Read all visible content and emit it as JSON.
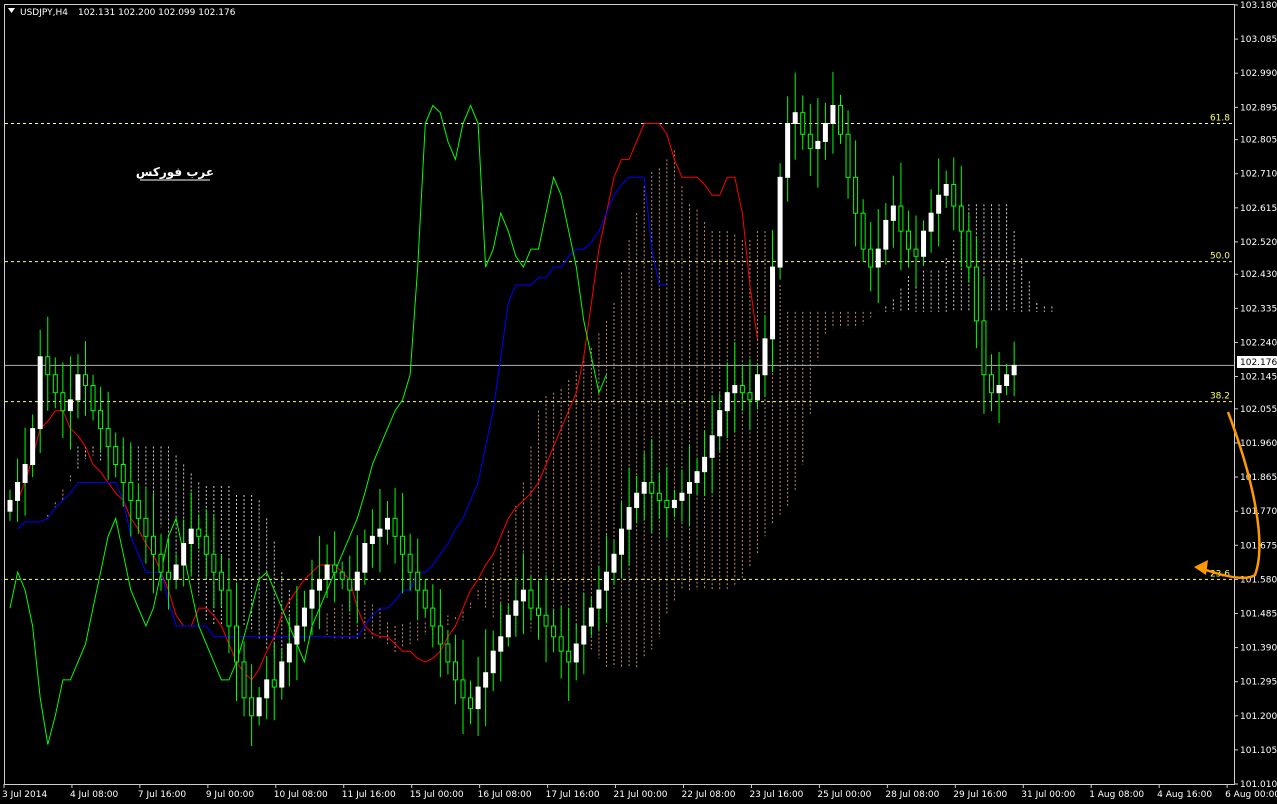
{
  "header": {
    "symbol": "USDJPY,H4",
    "ohlc": "102.131 102.200 102.099 102.176"
  },
  "watermark": "عرب فوركس",
  "current_price_label": "102.176",
  "colors": {
    "background": "#000000",
    "frame": "#cfcfcf",
    "bull_candle": "#ffffff",
    "bear_candle": "#00ff00",
    "wick": "#00ff00",
    "tenkan": "#ff0000",
    "kijun": "#0000ff",
    "chikou": "#00ff00",
    "kumo_a": "#f4b183",
    "kumo_b": "#ffffff",
    "fib_line": "#ffff66",
    "price_line": "#b0b0b0",
    "arrow": "#ff9900"
  },
  "chart_data": {
    "type": "candlestick",
    "instrument": "USDJPY",
    "timeframe": "H4",
    "ylim": [
      101.01,
      103.18
    ],
    "y_ticks": [
      "103.180",
      "103.085",
      "102.990",
      "102.895",
      "102.805",
      "102.710",
      "102.615",
      "102.520",
      "102.430",
      "102.335",
      "102.240",
      "102.145",
      "102.055",
      "101.960",
      "101.865",
      "101.770",
      "101.675",
      "101.580",
      "101.485",
      "101.390",
      "101.295",
      "101.200",
      "101.105",
      "101.010"
    ],
    "x_ticks": [
      {
        "label": "3 Jul 2014",
        "bar": 0
      },
      {
        "label": "4 Jul 08:00",
        "bar": 9
      },
      {
        "label": "7 Jul 16:00",
        "bar": 18
      },
      {
        "label": "9 Jul 00:00",
        "bar": 27
      },
      {
        "label": "10 Jul 08:00",
        "bar": 36
      },
      {
        "label": "11 Jul 16:00",
        "bar": 45
      },
      {
        "label": "15 Jul 00:00",
        "bar": 54
      },
      {
        "label": "16 Jul 08:00",
        "bar": 63
      },
      {
        "label": "17 Jul 16:00",
        "bar": 72
      },
      {
        "label": "21 Jul 00:00",
        "bar": 81
      },
      {
        "label": "22 Jul 08:00",
        "bar": 90
      },
      {
        "label": "23 Jul 16:00",
        "bar": 99
      },
      {
        "label": "25 Jul 00:00",
        "bar": 108
      },
      {
        "label": "28 Jul 08:00",
        "bar": 117
      },
      {
        "label": "29 Jul 16:00",
        "bar": 126
      },
      {
        "label": "31 Jul 00:00",
        "bar": 135
      },
      {
        "label": "1 Aug 08:00",
        "bar": 144
      },
      {
        "label": "4 Aug 16:00",
        "bar": 153
      },
      {
        "label": "6 Aug 00:00",
        "bar": 162
      }
    ],
    "last_price": 102.176,
    "fib_levels": [
      {
        "label": "61.8",
        "price": 102.85
      },
      {
        "label": "50.0",
        "price": 102.465
      },
      {
        "label": "38.2",
        "price": 102.075
      },
      {
        "label": "23.6",
        "price": 101.58
      }
    ],
    "closes": [
      101.8,
      101.85,
      101.9,
      102.0,
      102.2,
      102.15,
      102.1,
      102.05,
      102.08,
      102.15,
      102.12,
      102.05,
      102.0,
      101.95,
      101.9,
      101.85,
      101.8,
      101.75,
      101.7,
      101.65,
      101.6,
      101.58,
      101.62,
      101.68,
      101.72,
      101.7,
      101.65,
      101.6,
      101.55,
      101.45,
      101.35,
      101.25,
      101.2,
      101.25,
      101.3,
      101.28,
      101.35,
      101.4,
      101.45,
      101.5,
      101.55,
      101.58,
      101.62,
      101.6,
      101.58,
      101.55,
      101.6,
      101.68,
      101.7,
      101.72,
      101.75,
      101.7,
      101.65,
      101.6,
      101.55,
      101.5,
      101.45,
      101.4,
      101.35,
      101.3,
      101.25,
      101.22,
      101.28,
      101.32,
      101.38,
      101.42,
      101.48,
      101.52,
      101.55,
      101.5,
      101.48,
      101.45,
      101.42,
      101.38,
      101.35,
      101.4,
      101.45,
      101.5,
      101.55,
      101.6,
      101.65,
      101.72,
      101.78,
      101.82,
      101.85,
      101.82,
      101.8,
      101.78,
      101.8,
      101.82,
      101.85,
      101.88,
      101.92,
      101.98,
      102.05,
      102.1,
      102.12,
      102.1,
      102.08,
      102.15,
      102.25,
      102.45,
      102.7,
      102.85,
      102.88,
      102.82,
      102.78,
      102.8,
      102.85,
      102.9,
      102.82,
      102.7,
      102.6,
      102.5,
      102.45,
      102.5,
      102.58,
      102.62,
      102.55,
      102.5,
      102.48,
      102.55,
      102.6,
      102.65,
      102.68,
      102.62,
      102.55,
      102.45,
      102.3,
      102.15,
      102.1,
      102.12,
      102.15,
      102.176
    ],
    "tenkan": [
      101.8,
      101.85,
      101.92,
      102.0,
      102.02,
      102.05,
      102.05,
      102.0,
      101.98,
      101.95,
      101.9,
      101.88,
      101.85,
      101.82,
      101.8,
      101.75,
      101.72,
      101.68,
      101.65,
      101.6,
      101.55,
      101.48,
      101.45,
      101.45,
      101.5,
      101.5,
      101.48,
      101.45,
      101.4,
      101.35,
      101.32,
      101.3,
      101.33,
      101.38,
      101.42,
      101.48,
      101.52,
      101.55,
      101.58,
      101.6,
      101.62,
      101.62,
      101.62,
      101.6,
      101.58,
      101.5,
      101.45,
      101.43,
      101.42,
      101.42,
      101.4,
      101.38,
      101.38,
      101.36,
      101.35,
      101.36,
      101.38,
      101.42,
      101.45,
      101.5,
      101.55,
      101.58,
      101.62,
      101.65,
      101.7,
      101.75,
      101.78,
      101.8,
      101.82,
      101.85,
      101.9,
      101.95,
      102.0,
      102.05,
      102.1,
      102.2,
      102.35,
      102.5,
      102.6,
      102.7,
      102.75,
      102.75,
      102.8,
      102.85,
      102.85,
      102.85,
      102.82,
      102.75,
      102.7,
      102.7,
      102.7,
      102.68,
      102.65,
      102.65,
      102.7,
      102.7,
      102.6,
      102.4,
      102.25
    ],
    "kijun": [
      101.72,
      101.74,
      101.74,
      101.74,
      101.75,
      101.78,
      101.8,
      101.82,
      101.85,
      101.85,
      101.85,
      101.85,
      101.85,
      101.85,
      101.8,
      101.7,
      101.65,
      101.6,
      101.6,
      101.6,
      101.52,
      101.45,
      101.45,
      101.45,
      101.45,
      101.45,
      101.42,
      101.42,
      101.42,
      101.42,
      101.42,
      101.42,
      101.42,
      101.42,
      101.42,
      101.42,
      101.42,
      101.42,
      101.42,
      101.42,
      101.42,
      101.42,
      101.42,
      101.42,
      101.42,
      101.42,
      101.45,
      101.48,
      101.5,
      101.5,
      101.52,
      101.55,
      101.55,
      101.6,
      101.6,
      101.62,
      101.65,
      101.68,
      101.72,
      101.75,
      101.8,
      101.85,
      101.95,
      102.05,
      102.2,
      102.35,
      102.4,
      102.4,
      102.4,
      102.42,
      102.42,
      102.45,
      102.45,
      102.48,
      102.5,
      102.5,
      102.52,
      102.55,
      102.6,
      102.65,
      102.68,
      102.7,
      102.7,
      102.7,
      102.5,
      102.4,
      102.4
    ],
    "chikou": [
      101.5,
      101.6,
      101.55,
      101.45,
      101.25,
      101.12,
      101.2,
      101.3,
      101.3,
      101.35,
      101.4,
      101.5,
      101.6,
      101.7,
      101.75,
      101.65,
      101.55,
      101.5,
      101.45,
      101.5,
      101.6,
      101.7,
      101.75,
      101.65,
      101.55,
      101.45,
      101.4,
      101.35,
      101.3,
      101.3,
      101.35,
      101.42,
      101.5,
      101.58,
      101.6,
      101.55,
      101.5,
      101.45,
      101.4,
      101.35,
      101.45,
      101.5,
      101.55,
      101.6,
      101.65,
      101.7,
      101.75,
      101.82,
      101.9,
      101.95,
      102.0,
      102.05,
      102.08,
      102.15,
      102.45,
      102.85,
      102.9,
      102.88,
      102.8,
      102.75,
      102.85,
      102.9,
      102.85,
      102.45,
      102.5,
      102.6,
      102.55,
      102.48,
      102.45,
      102.5,
      102.5,
      102.6,
      102.7,
      102.65,
      102.55,
      102.45,
      102.3,
      102.2,
      102.1,
      102.15
    ]
  }
}
